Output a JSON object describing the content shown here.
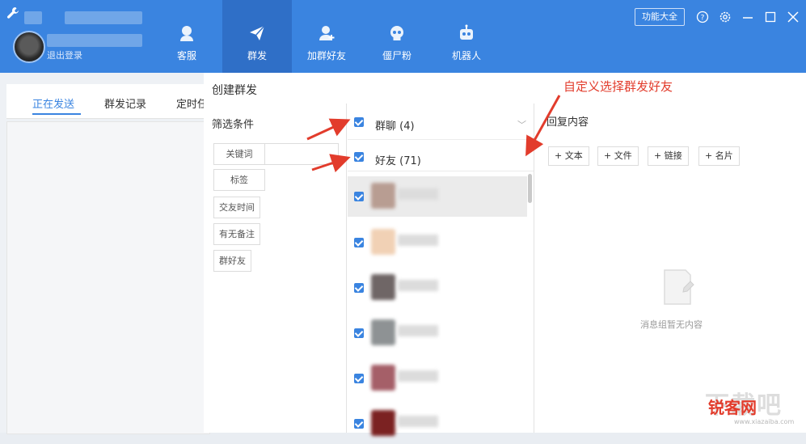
{
  "header": {
    "logout_label": "退出登录",
    "nav": [
      {
        "label": "客服",
        "icon": "customer-service-icon",
        "active": false
      },
      {
        "label": "群发",
        "icon": "paper-plane-icon",
        "active": true
      },
      {
        "label": "加群好友",
        "icon": "add-friend-icon",
        "active": false
      },
      {
        "label": "僵尸粉",
        "icon": "skull-icon",
        "active": false
      },
      {
        "label": "机器人",
        "icon": "robot-icon",
        "active": false
      }
    ],
    "function_button": "功能大全",
    "window_controls": [
      "help-icon",
      "settings-icon",
      "minimize-icon",
      "maximize-icon",
      "close-icon"
    ]
  },
  "subtabs": [
    "正在发送",
    "群发记录",
    "定时任"
  ],
  "dialog": {
    "title": "创建群发",
    "filter_title": "筛选条件",
    "filters": [
      "关键词",
      "标签",
      "交友时间",
      "有无备注",
      "群好友"
    ],
    "groups": [
      {
        "label": "群聊 (4)",
        "checked": true
      },
      {
        "label": "好友 (71)",
        "checked": true
      }
    ],
    "friends_visible": 7,
    "reply_title": "回复内容",
    "add_buttons": [
      "+ 文本",
      "+ 文件",
      "+ 链接",
      "+ 名片"
    ],
    "empty_text": "消息组暂无内容"
  },
  "annotation": "自定义选择群发好友",
  "watermark": {
    "main": "下载吧",
    "tag": "锐客网",
    "sub": "www.xiazaiba.com"
  },
  "colors": {
    "accent": "#3a84e0",
    "annotation": "#e23c2c"
  }
}
